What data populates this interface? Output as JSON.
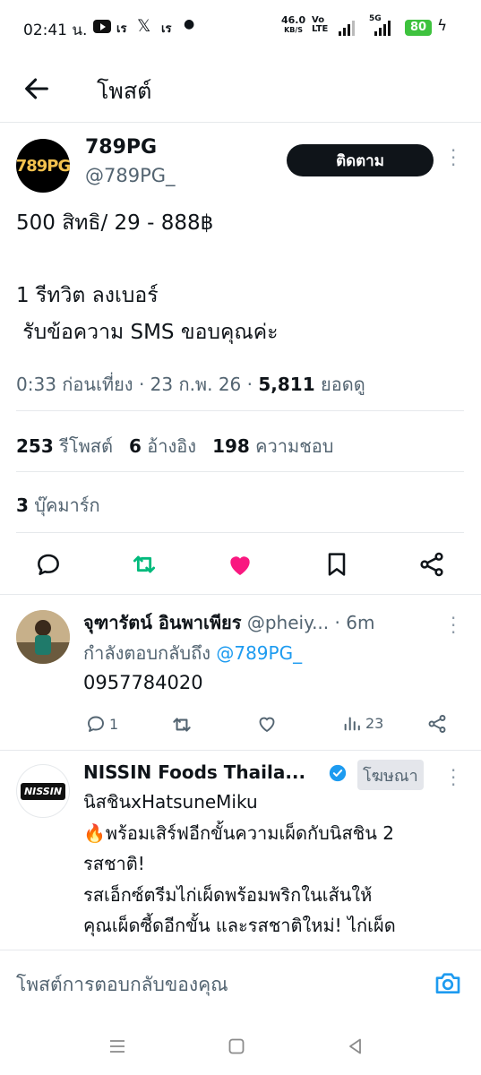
{
  "status_bar": {
    "time": "02:41 น.",
    "icons": [
      "youtube-icon",
      "rs-icon",
      "x-icon",
      "rs-icon",
      "dot-icon"
    ],
    "rs_label": "เร",
    "net_speed": "46.0",
    "net_unit": "KB/S",
    "volte": "Vo LTE",
    "network": "5G",
    "battery": "80"
  },
  "header": {
    "title": "โพสต์"
  },
  "post": {
    "author_name": "789PG",
    "author_handle": "@789PG_",
    "avatar_text": "789PG",
    "follow_label": "ติดตาม",
    "text_lines": [
      "500 สิทธิ/ 29 - 888฿",
      "1 รีทวิต ลงเบอร์",
      " รับข้อความ SMS ขอบคุณค่ะ"
    ],
    "time": "0:33 ก่อนเที่ยง",
    "date": "23 ก.พ. 26",
    "views": "5,811",
    "views_label": "ยอดดู",
    "reposts": "253",
    "reposts_label": "รีโพสต์",
    "quotes": "6",
    "quotes_label": "อ้างอิง",
    "likes": "198",
    "likes_label": "ความชอบ",
    "bookmarks": "3",
    "bookmarks_label": "บุ๊คมาร์ก",
    "liked": true,
    "colors": {
      "repost": "#00ba7c",
      "like": "#f91880",
      "link": "#1d9bf0"
    }
  },
  "reply": {
    "name": "จุฑารัตน์ อินพาเพียร",
    "handle": "@pheiy...",
    "time": "6m",
    "replying_label": "กำลังตอบกลับถึง",
    "replying_to": "@789PG_",
    "text": "0957784020",
    "reply_count": "1",
    "views": "23"
  },
  "ad": {
    "name": "NISSIN Foods Thaila...",
    "badge": "โฆษณา",
    "avatar_text": "NISSIN",
    "lines": [
      "นิสชินxHatsuneMiku",
      "🔥พร้อมเสิร์ฟอีกขั้นความเผ็ดกับนิสชิน 2",
      "รสชาติ!",
      "รสเอ็กซ์ตรีมไก่เผ็ดพร้อมพริกในเส้นให้",
      "คุณเผ็ดซี้ดอีกขั้น และรสชาติใหม่! ไก่เผ็ด"
    ]
  },
  "composer": {
    "placeholder": "โพสต์การตอบกลับของคุณ"
  }
}
